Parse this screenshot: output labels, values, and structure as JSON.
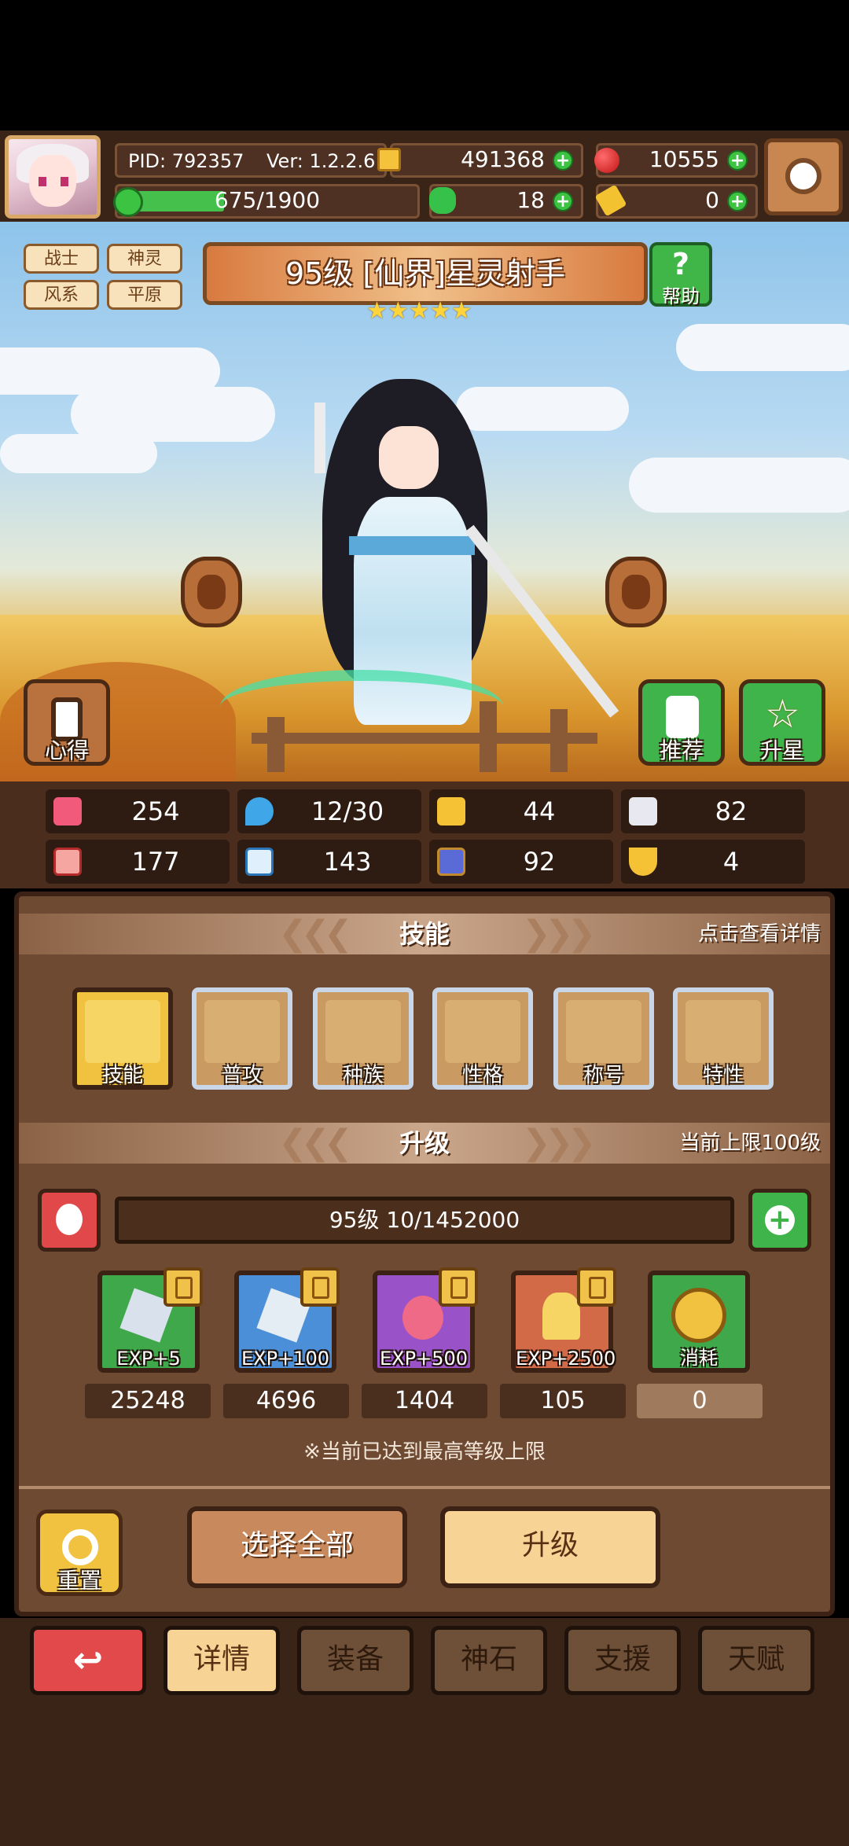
{
  "header": {
    "pid": "PID: 792357",
    "ver": "Ver: 1.2.2.6",
    "exp": "675/1900",
    "gold": "491368",
    "gems": "10555",
    "clover": "18",
    "ticket": "0"
  },
  "tags": [
    "战士",
    "神灵",
    "风系",
    "平原"
  ],
  "hero": {
    "title": "95级  [仙界]星灵射手",
    "stars": "★★★★★",
    "help_label": "帮助"
  },
  "scene_buttons": {
    "left": "心得",
    "recommend": "推荐",
    "star_up": "升星"
  },
  "stats": [
    "254",
    "12/30",
    "44",
    "82",
    "177",
    "143",
    "92",
    "4"
  ],
  "skills_section": {
    "title": "技能",
    "hint": "点击查看详情",
    "items": [
      "技能",
      "普攻",
      "种族",
      "性格",
      "称号",
      "特性"
    ]
  },
  "upgrade_section": {
    "title": "升级",
    "hint": "当前上限100级",
    "level_text": "95级  10/1452000",
    "items": [
      {
        "label": "EXP+5",
        "count": "25248"
      },
      {
        "label": "EXP+100",
        "count": "4696"
      },
      {
        "label": "EXP+500",
        "count": "1404"
      },
      {
        "label": "EXP+2500",
        "count": "105"
      },
      {
        "label": "消耗",
        "count": "0"
      }
    ],
    "notice": "※当前已达到最高等级上限",
    "reset": "重置",
    "select_all": "选择全部",
    "upgrade": "升级"
  },
  "nav": [
    "详情",
    "装备",
    "神石",
    "支援",
    "天赋"
  ],
  "colors": {
    "accent_green": "#3cc342",
    "panel_brown": "#6e4a33",
    "back_red": "#e2494a"
  }
}
